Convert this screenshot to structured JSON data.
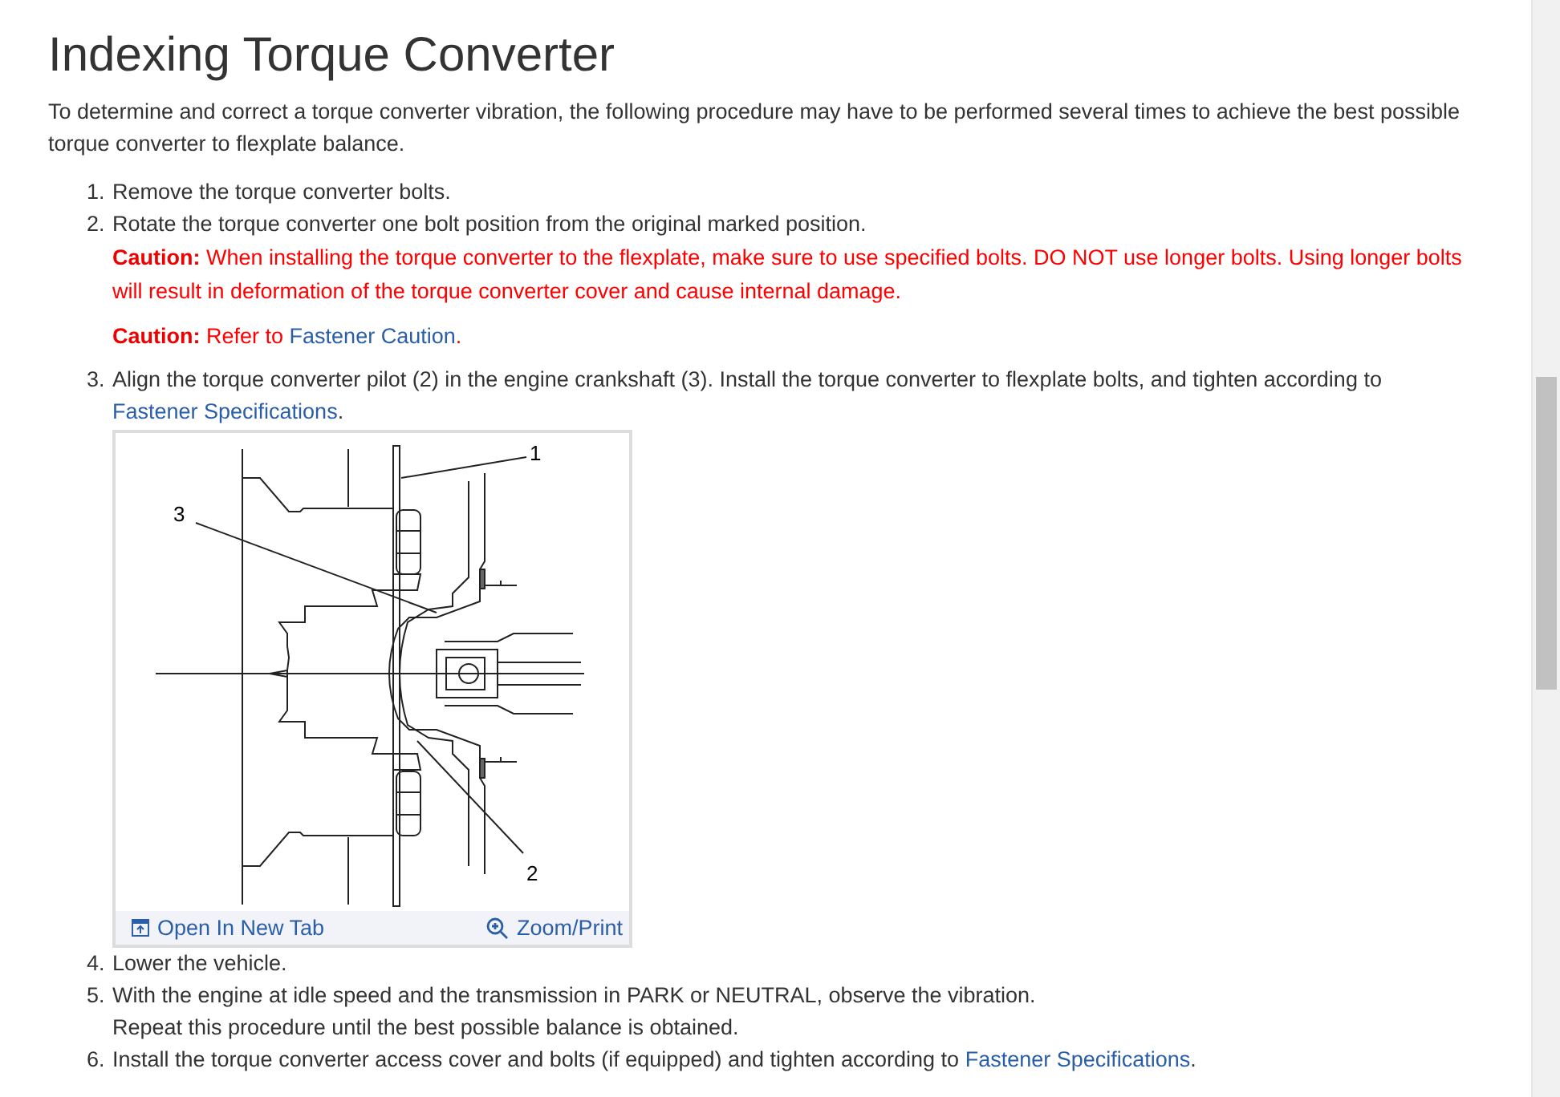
{
  "title": "Indexing Torque Converter",
  "intro": "To determine and correct a torque converter vibration, the following procedure may have to be performed several times to achieve the best possible torque converter to flexplate balance.",
  "steps": [
    {
      "number": "1.",
      "text": "Remove the torque converter bolts."
    },
    {
      "number": "2.",
      "text": "Rotate the torque converter one bolt position from the original marked position.",
      "cautions": [
        {
          "label": "Caution:",
          "text": "When installing the torque converter to the flexplate, make sure to use specified bolts. DO NOT use longer bolts. Using longer bolts will result in deformation of the torque converter cover and cause internal damage."
        },
        {
          "label": "Caution:",
          "text": "Refer to",
          "link": "Fastener Caution",
          "suffix": "."
        }
      ]
    },
    {
      "number": "3.",
      "text": "Align the torque converter pilot (2) in the engine crankshaft (3). Install the torque converter to flexplate bolts, and tighten according to",
      "link": "Fastener Specifications",
      "suffix": ".",
      "figure": {
        "callouts": [
          "1",
          "2",
          "3"
        ],
        "open_link": "Open In New Tab",
        "zoom_link": "Zoom/Print"
      }
    },
    {
      "number": "4.",
      "text": "Lower the vehicle."
    },
    {
      "number": "5.",
      "text": "With the engine at idle speed and the transmission in PARK or NEUTRAL, observe the vibration.",
      "continuation": "Repeat this procedure until the best possible balance is obtained."
    },
    {
      "number": "6.",
      "text": "Install the torque converter access cover and bolts (if equipped) and tighten according to",
      "link": "Fastener Specifications",
      "suffix": "."
    }
  ]
}
